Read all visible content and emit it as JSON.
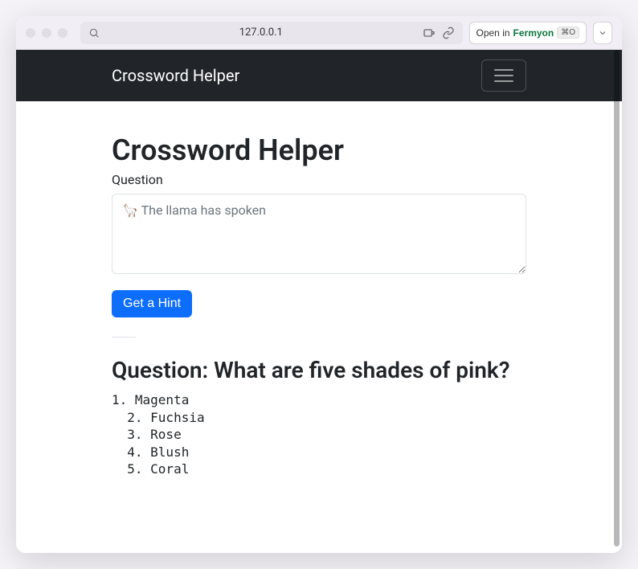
{
  "browser": {
    "address": "127.0.0.1",
    "open_in_prefix": "Open in ",
    "open_in_brand": "Fermyon",
    "shortcut": "⌘O"
  },
  "navbar": {
    "brand": "Crossword Helper"
  },
  "page": {
    "title": "Crossword Helper",
    "question_label": "Question",
    "textarea_placeholder": "🦙 The llama has spoken",
    "submit_button": "Get a Hint"
  },
  "result": {
    "heading": "Question: What are five shades of pink?",
    "body": "1. Magenta\n  2. Fuchsia\n  3. Rose\n  4. Blush\n  5. Coral"
  }
}
